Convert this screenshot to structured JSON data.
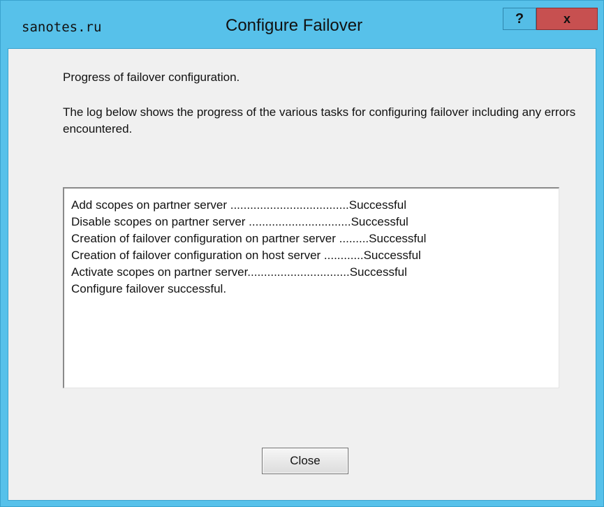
{
  "window": {
    "watermark": "sanotes.ru",
    "title": "Configure Failover",
    "help_glyph": "?",
    "close_glyph": "x"
  },
  "content": {
    "heading": "Progress of failover configuration.",
    "description": "The log below shows the progress of the various tasks for configuring failover including any errors encountered."
  },
  "log": {
    "lines": [
      "Add scopes on partner server ....................................Successful",
      "Disable scopes on partner server ...............................Successful",
      "Creation of failover configuration on partner server .........Successful",
      "Creation of failover configuration on host server ............Successful",
      "Activate scopes on partner server...............................Successful",
      "Configure failover successful."
    ]
  },
  "buttons": {
    "close_label": "Close"
  },
  "colors": {
    "title_bar": "#57c1ea",
    "close_x_button": "#c75050",
    "client_background": "#f0f0f0"
  }
}
